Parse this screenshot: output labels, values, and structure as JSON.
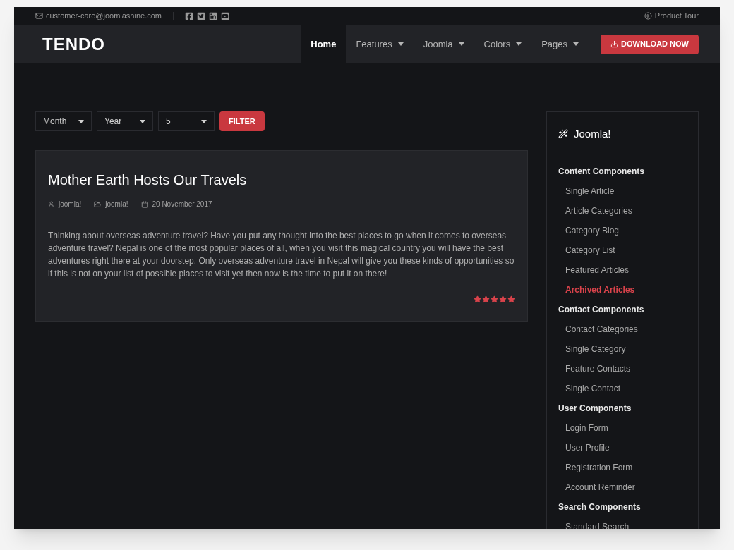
{
  "topbar": {
    "email": "customer-care@joomlashine.com",
    "social": [
      {
        "kind": "facebook"
      },
      {
        "kind": "twitter"
      },
      {
        "kind": "linkedin"
      },
      {
        "kind": "youtube"
      }
    ],
    "tour": "Product Tour"
  },
  "logo": "TENDO",
  "nav": [
    {
      "label": "Home",
      "selected": true,
      "dropdown": false
    },
    {
      "label": "Features",
      "selected": false,
      "dropdown": true
    },
    {
      "label": "Joomla",
      "selected": false,
      "dropdown": true
    },
    {
      "label": "Colors",
      "selected": false,
      "dropdown": true
    },
    {
      "label": "Pages",
      "selected": false,
      "dropdown": true
    }
  ],
  "download_button": "DOWNLOAD NOW",
  "filters": [
    {
      "value": "Month"
    },
    {
      "value": "Year"
    },
    {
      "value": "5"
    }
  ],
  "filter_button": "FILTER",
  "article": {
    "title": "Mother Earth Hosts Our Travels",
    "author": "joomla!",
    "category": "joomla!",
    "date": "20 November 2017",
    "body": "Thinking about overseas adventure travel? Have you put any thought into the best places to go when it comes to overseas adventure travel? Nepal is one of the most popular places of all, when you visit this magical country you will have the best adventures right there at your doorstep. Only overseas adventure travel in Nepal will give you these kinds of opportunities so if this is not on your list of possible places to visit yet then now is the time to put it on there!",
    "stars": 5
  },
  "sidebar": {
    "title": "Joomla!",
    "sections": [
      {
        "heading": "Content Components",
        "items": [
          {
            "label": "Single Article",
            "selected": false
          },
          {
            "label": "Article Categories",
            "selected": false
          },
          {
            "label": "Category Blog",
            "selected": false
          },
          {
            "label": "Category List",
            "selected": false
          },
          {
            "label": "Featured Articles",
            "selected": false
          },
          {
            "label": "Archived Articles",
            "selected": true
          }
        ]
      },
      {
        "heading": "Contact Components",
        "items": [
          {
            "label": "Contact Categories",
            "selected": false
          },
          {
            "label": "Single Category",
            "selected": false
          },
          {
            "label": "Feature Contacts",
            "selected": false
          },
          {
            "label": "Single Contact",
            "selected": false
          }
        ]
      },
      {
        "heading": "User Components",
        "items": [
          {
            "label": "Login Form",
            "selected": false
          },
          {
            "label": "User Profile",
            "selected": false
          },
          {
            "label": "Registration Form",
            "selected": false
          },
          {
            "label": "Account Reminder",
            "selected": false
          }
        ]
      },
      {
        "heading": "Search Components",
        "items": [
          {
            "label": "Standard Search",
            "selected": false
          }
        ]
      }
    ]
  }
}
